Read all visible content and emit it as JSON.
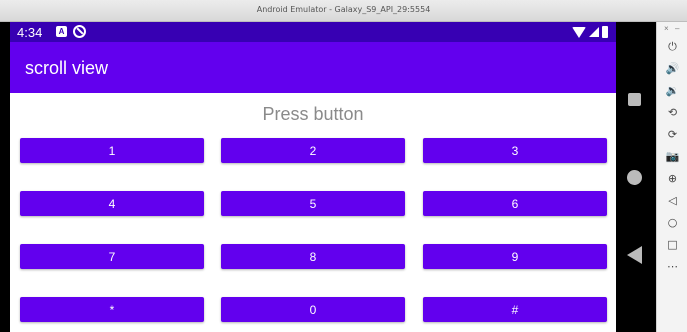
{
  "window": {
    "title": "Android Emulator - Galaxy_S9_API_29:5554"
  },
  "status_bar": {
    "time": "4:34",
    "notification_icon_a": "A"
  },
  "app_bar": {
    "title": "scroll view"
  },
  "display": {
    "text": "Press button"
  },
  "keypad": {
    "keys": [
      "1",
      "2",
      "3",
      "4",
      "5",
      "6",
      "7",
      "8",
      "9",
      "*",
      "0",
      "#"
    ]
  },
  "colors": {
    "status_bar": "#3700b3",
    "app_bar": "#6200ee",
    "button": "#6200ee",
    "display_text": "#8a8a8a"
  },
  "toolbar": {
    "close_glyph": "×",
    "minimize_glyph": "–",
    "icons": [
      "power-icon",
      "volume-up-icon",
      "volume-down-icon",
      "rotate-left-icon",
      "rotate-right-icon",
      "camera-icon",
      "zoom-icon",
      "back-icon",
      "home-icon",
      "overview-icon",
      "more-icon"
    ],
    "glyphs": [
      "⏻",
      "🔊",
      "🔉",
      "⟲",
      "⟳",
      "📷",
      "⊕",
      "◁",
      "○",
      "□",
      "⋯"
    ]
  }
}
